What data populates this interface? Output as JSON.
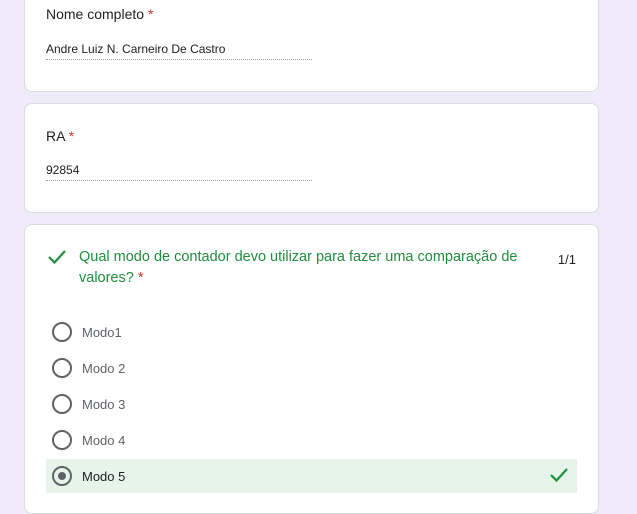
{
  "form": {
    "name_question": {
      "label": "Nome completo",
      "required_mark": "*",
      "answer": "Andre Luiz N. Carneiro De Castro"
    },
    "ra_question": {
      "label": "RA",
      "required_mark": "*",
      "answer": "92854"
    },
    "mc_question": {
      "text": "Qual modo de contador devo utilizar para fazer uma comparação de valores?",
      "required_mark": "*",
      "score": "1/1",
      "options": [
        {
          "label": "Modo1",
          "selected": false
        },
        {
          "label": "Modo 2",
          "selected": false
        },
        {
          "label": "Modo 3",
          "selected": false
        },
        {
          "label": "Modo 4",
          "selected": false
        },
        {
          "label": "Modo 5",
          "selected": true
        }
      ]
    }
  },
  "colors": {
    "page_background": "#f0ebf8",
    "correct_green": "#1e8e3e",
    "selected_background": "#e6f4ea",
    "required_red": "#d93025"
  },
  "icons": {
    "correct": "check-icon"
  }
}
